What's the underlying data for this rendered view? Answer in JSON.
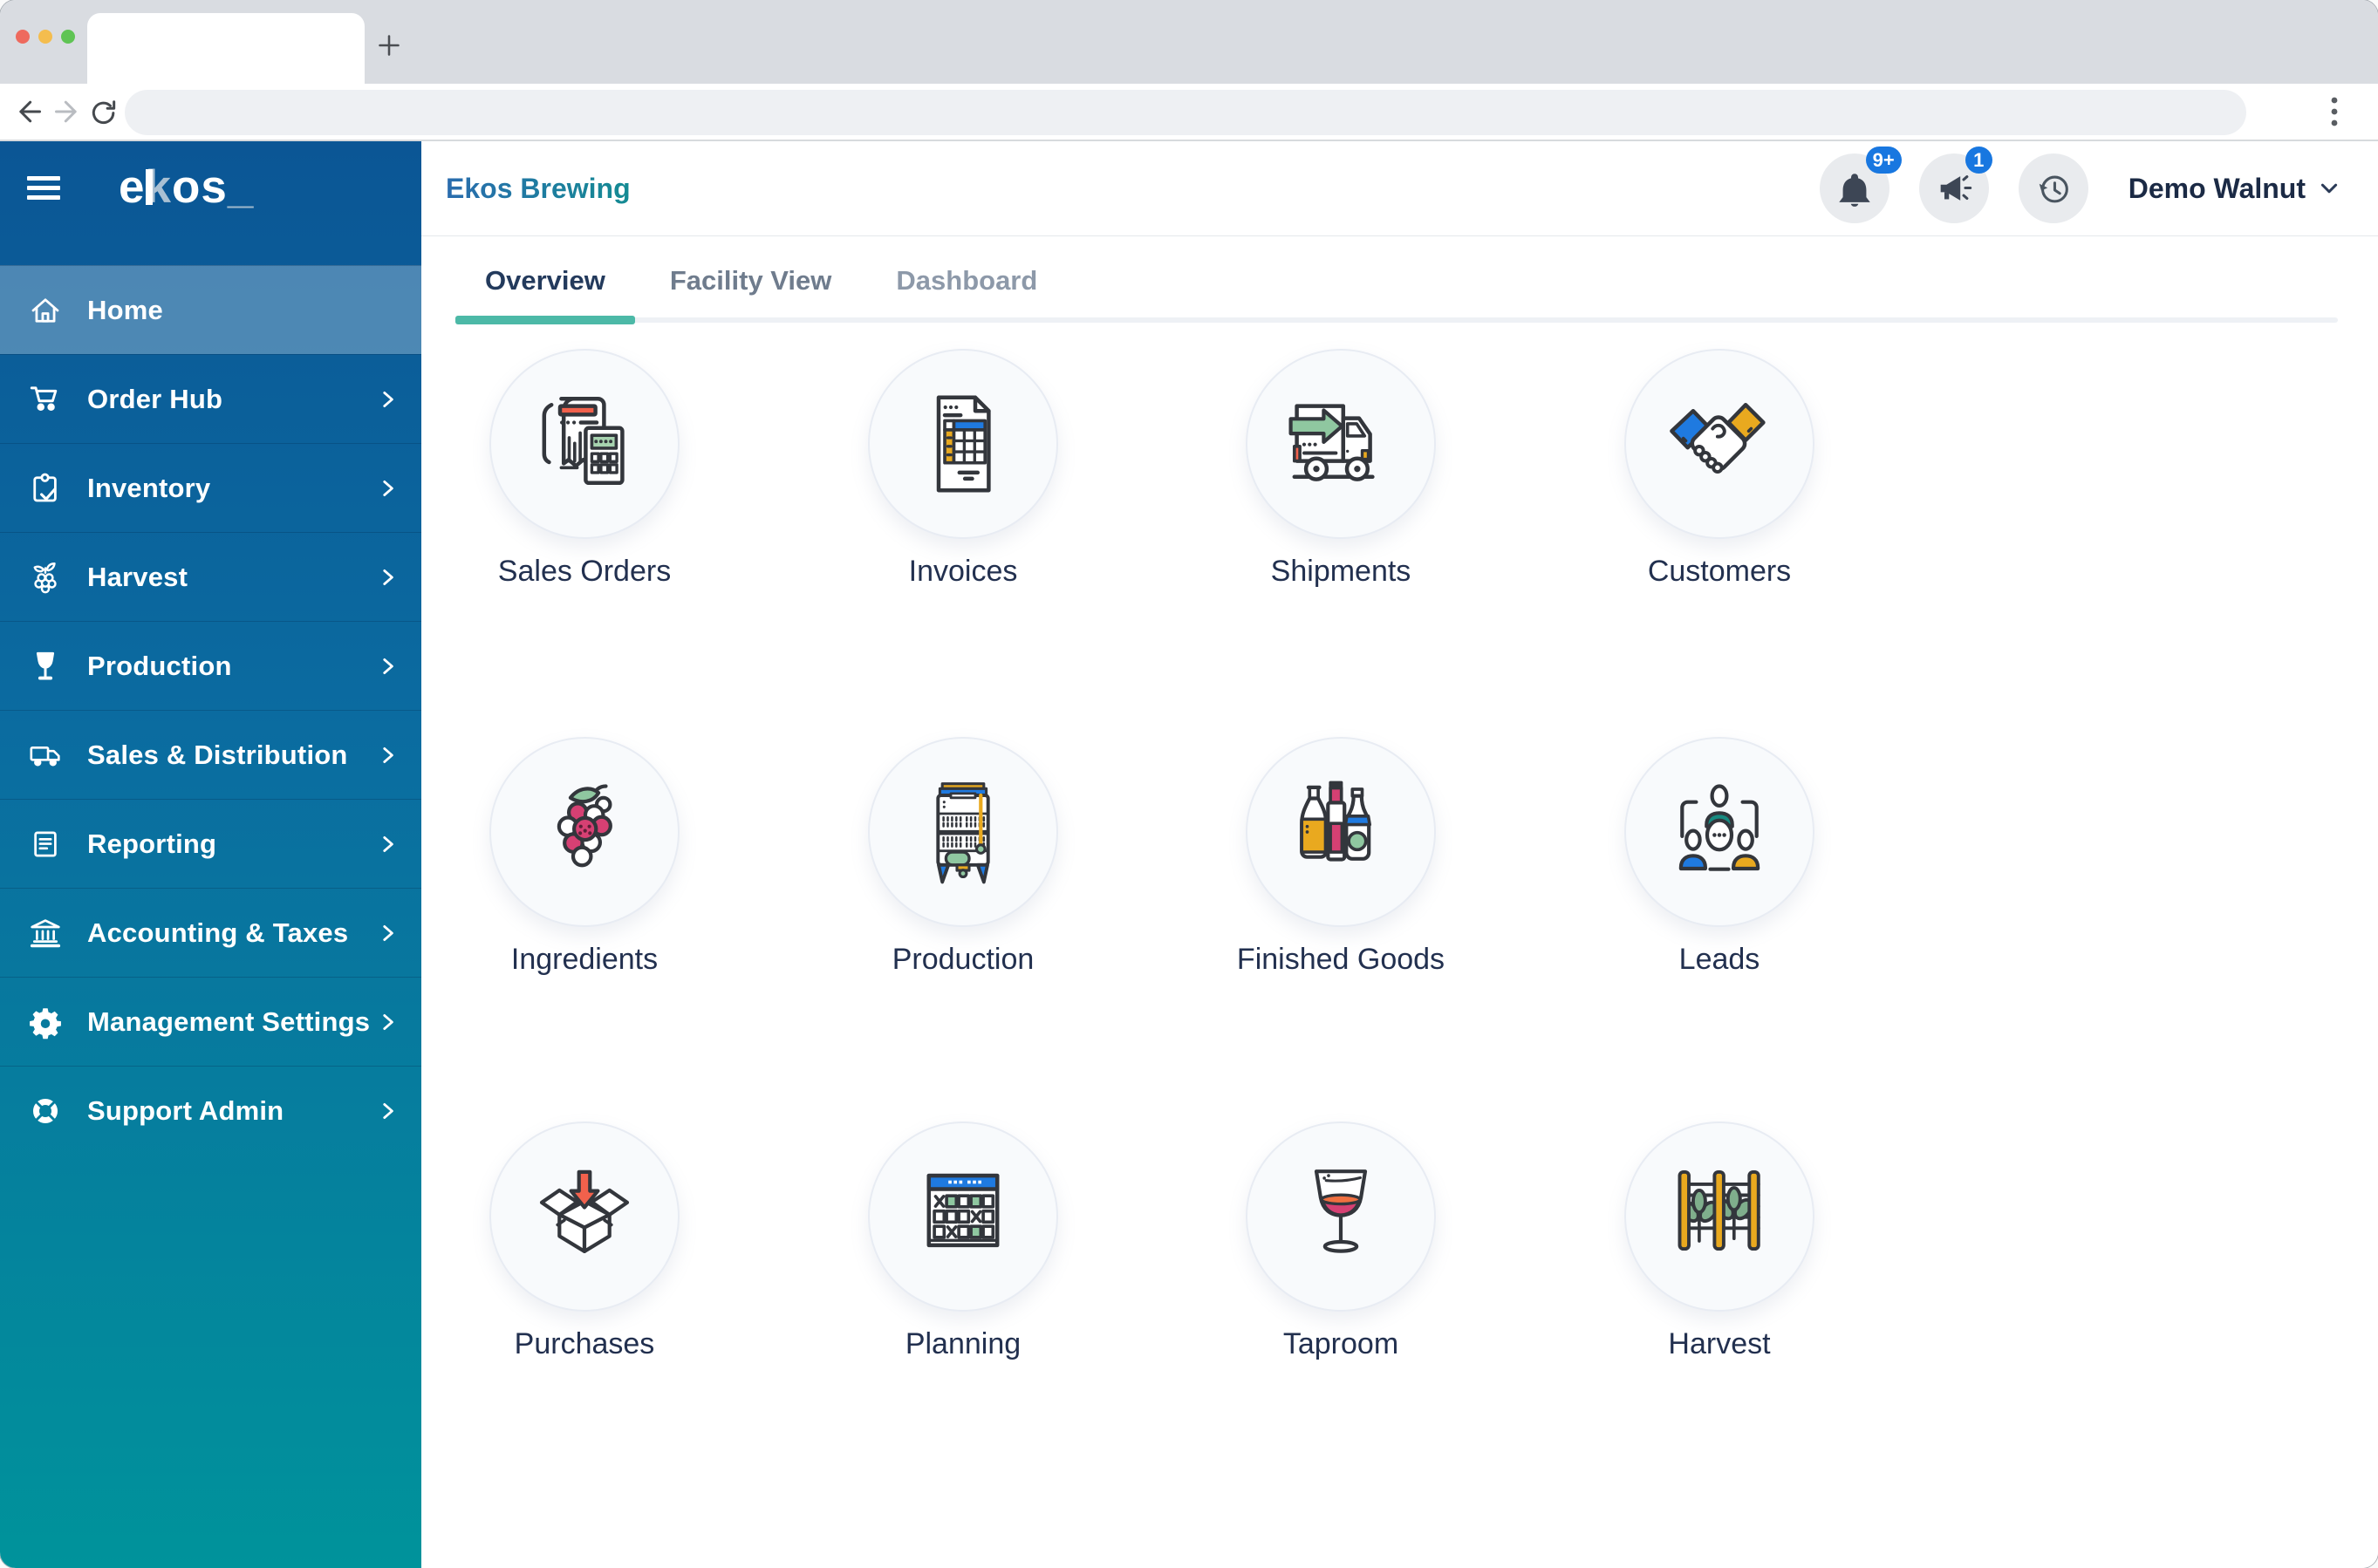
{
  "browser": {
    "address_value": ""
  },
  "sidebar": {
    "logo": {
      "e": "e",
      "k": "k",
      "os": "os",
      "underscore": "_"
    },
    "items": [
      {
        "label": "Home",
        "icon": "home-icon",
        "active": true,
        "expandable": false
      },
      {
        "label": "Order Hub",
        "icon": "cart-icon",
        "expandable": true
      },
      {
        "label": "Inventory",
        "icon": "clipboard-check-icon",
        "expandable": true
      },
      {
        "label": "Harvest",
        "icon": "berries-icon",
        "expandable": true
      },
      {
        "label": "Production",
        "icon": "wine-glass-icon",
        "expandable": true
      },
      {
        "label": "Sales & Distribution",
        "icon": "truck-icon",
        "expandable": true
      },
      {
        "label": "Reporting",
        "icon": "report-icon",
        "expandable": true
      },
      {
        "label": "Accounting & Taxes",
        "icon": "bank-icon",
        "expandable": true
      },
      {
        "label": "Management Settings",
        "icon": "gear-icon",
        "expandable": true
      },
      {
        "label": "Support Admin",
        "icon": "life-ring-icon",
        "expandable": true
      }
    ]
  },
  "header": {
    "company_name": "Ekos Brewing",
    "notifications_badge": "9+",
    "announcements_badge": "1",
    "user_menu_label": "Demo Walnut"
  },
  "tabs": {
    "items": [
      {
        "label": "Overview",
        "active": true
      },
      {
        "label": "Facility View",
        "active": false
      },
      {
        "label": "Dashboard",
        "active": false
      }
    ]
  },
  "tiles": {
    "items": [
      {
        "label": "Sales Orders",
        "icon": "sales-orders-illustration"
      },
      {
        "label": "Invoices",
        "icon": "invoices-illustration"
      },
      {
        "label": "Shipments",
        "icon": "shipments-illustration"
      },
      {
        "label": "Customers",
        "icon": "customers-illustration"
      },
      {
        "label": "Ingredients",
        "icon": "ingredients-illustration"
      },
      {
        "label": "Production",
        "icon": "production-illustration"
      },
      {
        "label": "Finished Goods",
        "icon": "finished-goods-illustration"
      },
      {
        "label": "Leads",
        "icon": "leads-illustration"
      },
      {
        "label": "Purchases",
        "icon": "purchases-illustration"
      },
      {
        "label": "Planning",
        "icon": "planning-illustration"
      },
      {
        "label": "Taproom",
        "icon": "taproom-illustration"
      },
      {
        "label": "Harvest",
        "icon": "harvest-illustration"
      }
    ]
  },
  "colors": {
    "accent_teal": "#4CB9A7",
    "badge_blue": "#1877E0",
    "sidebar_top": "#0B5695",
    "sidebar_bottom": "#00939B"
  }
}
